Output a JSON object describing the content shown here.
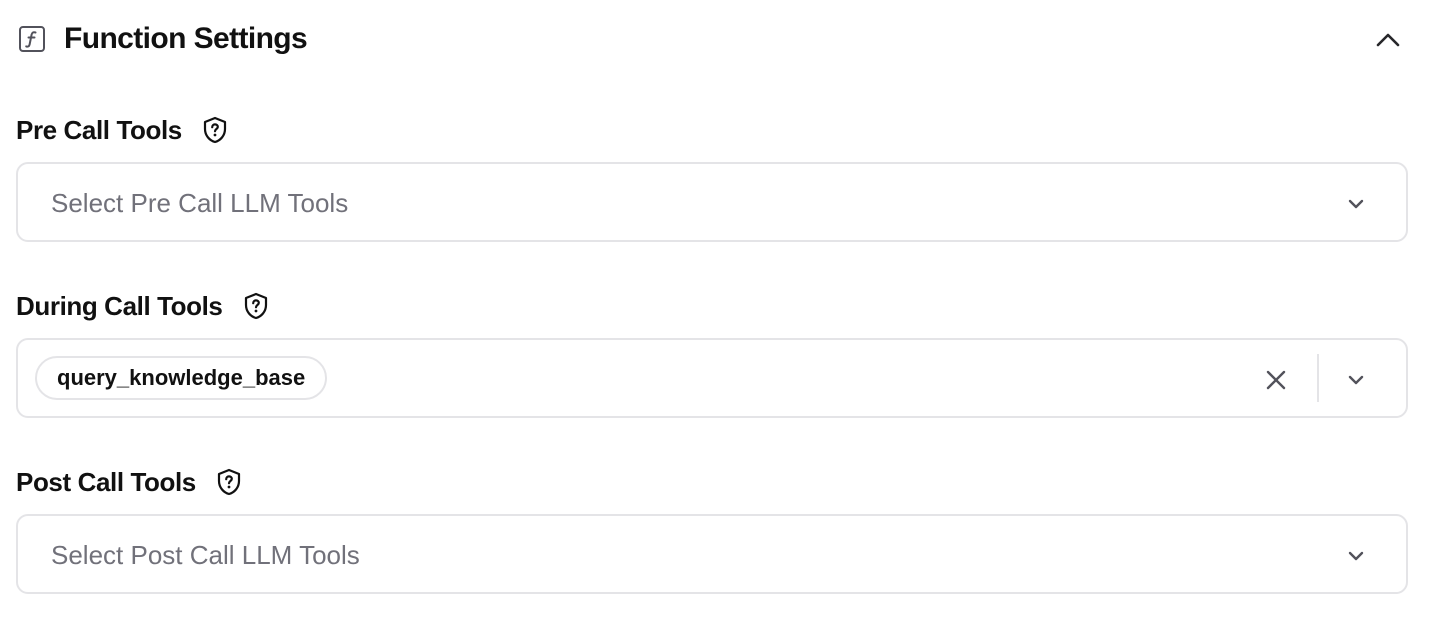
{
  "header": {
    "icon": "function-icon",
    "title": "Function Settings",
    "collapse_icon": "chevron-up-icon"
  },
  "pre_call": {
    "label": "Pre Call Tools",
    "help_icon": "shield-question-icon",
    "placeholder": "Select Pre Call LLM Tools",
    "dropdown_icon": "chevron-down-icon"
  },
  "during_call": {
    "label": "During Call Tools",
    "help_icon": "shield-question-icon",
    "selected": [
      "query_knowledge_base"
    ],
    "clear_icon": "close-icon",
    "dropdown_icon": "chevron-down-icon"
  },
  "post_call": {
    "label": "Post Call Tools",
    "help_icon": "shield-question-icon",
    "placeholder": "Select Post Call LLM Tools",
    "dropdown_icon": "chevron-down-icon"
  },
  "colors": {
    "text": "#111111",
    "placeholder": "#71717a",
    "border": "#e4e4e7",
    "icon": "#52525b"
  }
}
